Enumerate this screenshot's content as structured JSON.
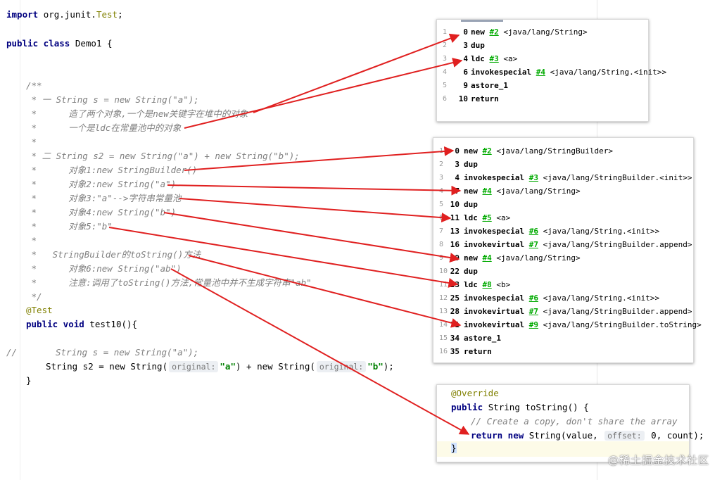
{
  "editor": {
    "import_kw": "import",
    "import_path": "org.junit.",
    "import_class": "Test",
    "import_end": ";",
    "class_kw": "public class",
    "class_decl": "Demo1 {",
    "comment_lines": [
      "/**",
      " * 一 String s = new String(\"a\");",
      " *      造了两个对象,一个是new关键字在堆中的对象",
      " *      一个是ldc在常量池中的对象",
      " *",
      " * 二 String s2 = new String(\"a\") + new String(\"b\");",
      " *      对象1:new StringBuilder()",
      " *      对象2:new String(\"a\")",
      " *      对象3:\"a\"-->字符串常量池",
      " *      对象4:new String(\"b\")",
      " *      对象5:\"b\"",
      " *",
      " *   StringBuilder的toString()方法",
      " *      对象6:new String(\"ab\")",
      " *      注意:调用了toString()方法,常量池中并不生成字符串\"ab\"",
      " */"
    ],
    "annotation": "@Test",
    "method_kw": "public void",
    "method_decl": "test10(){",
    "slashes": "//",
    "commented_code": "String s = new String(\"a\");",
    "stmt_prefix": "String s2 = new String(",
    "hint1": "original:",
    "val_a": "\"a\"",
    "stmt_mid": ") + new String(",
    "hint2": "original:",
    "val_b": "\"b\"",
    "stmt_end": ");",
    "close_brace": "}"
  },
  "bytecode_panel_1": {
    "rows": [
      {
        "num": "1",
        "off": "0",
        "op": "new",
        "ref": "#2",
        "arg": "<java/lang/String>"
      },
      {
        "num": "2",
        "off": "3",
        "op": "dup",
        "ref": "",
        "arg": ""
      },
      {
        "num": "3",
        "off": "4",
        "op": "ldc",
        "ref": "#3",
        "arg": "<a>"
      },
      {
        "num": "4",
        "off": "6",
        "op": "invokespecial",
        "ref": "#4",
        "arg": "<java/lang/String.<init>>"
      },
      {
        "num": "5",
        "off": "9",
        "op": "astore_1",
        "ref": "",
        "arg": ""
      },
      {
        "num": "6",
        "off": "10",
        "op": "return",
        "ref": "",
        "arg": ""
      }
    ]
  },
  "bytecode_panel_2": {
    "rows": [
      {
        "num": "1",
        "off": "0",
        "op": "new",
        "ref": "#2",
        "arg": "<java/lang/StringBuilder>"
      },
      {
        "num": "2",
        "off": "3",
        "op": "dup",
        "ref": "",
        "arg": ""
      },
      {
        "num": "3",
        "off": "4",
        "op": "invokespecial",
        "ref": "#3",
        "arg": "<java/lang/StringBuilder.<init>>"
      },
      {
        "num": "4",
        "off": "7",
        "op": "new",
        "ref": "#4",
        "arg": "<java/lang/String>"
      },
      {
        "num": "5",
        "off": "10",
        "op": "dup",
        "ref": "",
        "arg": ""
      },
      {
        "num": "6",
        "off": "11",
        "op": "ldc",
        "ref": "#5",
        "arg": "<a>"
      },
      {
        "num": "7",
        "off": "13",
        "op": "invokespecial",
        "ref": "#6",
        "arg": "<java/lang/String.<init>>"
      },
      {
        "num": "8",
        "off": "16",
        "op": "invokevirtual",
        "ref": "#7",
        "arg": "<java/lang/StringBuilder.append>"
      },
      {
        "num": "9",
        "off": "19",
        "op": "new",
        "ref": "#4",
        "arg": "<java/lang/String>"
      },
      {
        "num": "10",
        "off": "22",
        "op": "dup",
        "ref": "",
        "arg": ""
      },
      {
        "num": "11",
        "off": "23",
        "op": "ldc",
        "ref": "#8",
        "arg": "<b>"
      },
      {
        "num": "12",
        "off": "25",
        "op": "invokespecial",
        "ref": "#6",
        "arg": "<java/lang/String.<init>>"
      },
      {
        "num": "13",
        "off": "28",
        "op": "invokevirtual",
        "ref": "#7",
        "arg": "<java/lang/StringBuilder.append>"
      },
      {
        "num": "14",
        "off": "31",
        "op": "invokevirtual",
        "ref": "#9",
        "arg": "<java/lang/StringBuilder.toString>"
      },
      {
        "num": "15",
        "off": "34",
        "op": "astore_1",
        "ref": "",
        "arg": ""
      },
      {
        "num": "16",
        "off": "35",
        "op": "return",
        "ref": "",
        "arg": ""
      }
    ]
  },
  "override_panel": {
    "annotation": "@Override",
    "sig_kw": "public",
    "sig_rest": "String toString() {",
    "comment": "// Create a copy, don't share the array",
    "ret_kw": "return new",
    "ret_call": "String(value,",
    "hint": "offset:",
    "ret_rest": "0, count);",
    "close": "}"
  },
  "watermark": "@稀土掘金技术社区",
  "colors": {
    "arrow": "#e02020",
    "keyword": "#000080",
    "comment": "#808080",
    "annotation": "#808000",
    "ref": "#00aa00"
  }
}
